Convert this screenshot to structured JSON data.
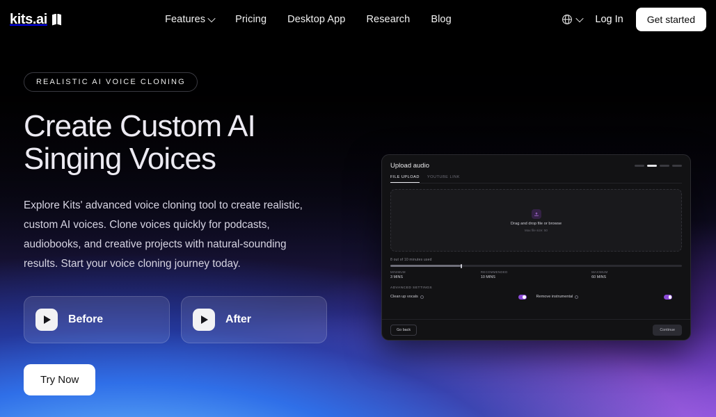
{
  "header": {
    "logo_text": "kits.ai",
    "logo_mark": "kits-logo-mark",
    "nav": [
      {
        "label": "Features",
        "has_dropdown": true
      },
      {
        "label": "Pricing",
        "has_dropdown": false
      },
      {
        "label": "Desktop App",
        "has_dropdown": false
      },
      {
        "label": "Research",
        "has_dropdown": false
      },
      {
        "label": "Blog",
        "has_dropdown": false
      }
    ],
    "language_icon": "globe-icon",
    "login_label": "Log In",
    "cta_label": "Get started"
  },
  "hero": {
    "badge": "REALISTIC AI VOICE CLONING",
    "title_line1": "Create Custom AI",
    "title_line2": "Singing Voices",
    "paragraph": "Explore Kits' advanced voice cloning tool to create realistic, custom AI voices. Clone voices quickly for podcasts, audiobooks, and creative projects with natural-sounding results. Start your voice cloning journey today.",
    "samples": [
      {
        "label": "Before",
        "icon": "play-icon"
      },
      {
        "label": "After",
        "icon": "play-icon"
      }
    ],
    "try_label": "Try Now"
  },
  "mockup": {
    "title": "Upload audio",
    "step_count": 4,
    "active_step": 2,
    "tabs": [
      {
        "label": "File upload",
        "active": true
      },
      {
        "label": "Youtube link",
        "active": false
      }
    ],
    "dropzone": {
      "icon": "upload-icon",
      "main": "Drag and drop file or browse",
      "sub": "Max file size: 50"
    },
    "usage": {
      "label": "8 out of 10 minutes used",
      "percent": 24,
      "marks": [
        {
          "name": "Minimum",
          "value": "3 mins"
        },
        {
          "name": "Recommended",
          "value": "10 mins"
        },
        {
          "name": "Maximum",
          "value": "60 mins"
        }
      ]
    },
    "advanced": {
      "title": "Advanced settings",
      "options": [
        {
          "label": "Clean up vocals",
          "enabled": true,
          "icon": "info-icon"
        },
        {
          "label": "Remove instrumental",
          "enabled": true,
          "icon": "info-icon"
        }
      ]
    },
    "footer": {
      "back_label": "Go back",
      "continue_label": "Continue"
    }
  },
  "colors": {
    "accent_purple": "#8b4ad8",
    "cta_white": "#ffffff",
    "page_black": "#000000"
  }
}
